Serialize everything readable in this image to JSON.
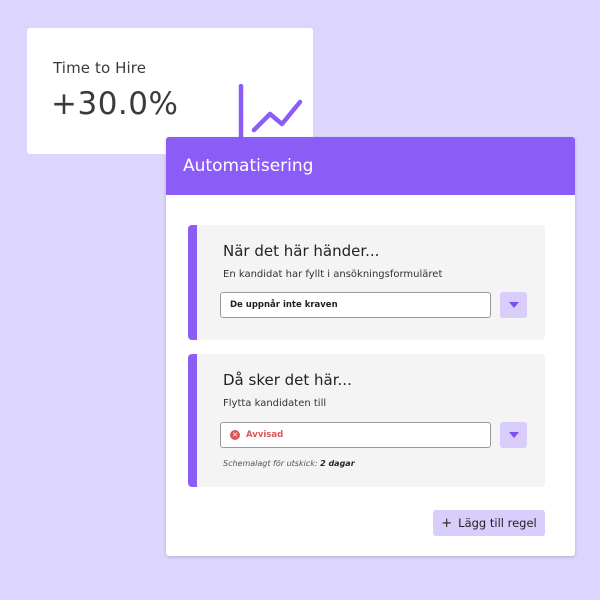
{
  "stat": {
    "label": "Time to Hire",
    "value": "+30.0%",
    "icon": "line-chart-icon",
    "icon_color": "#8b5cf6"
  },
  "automation": {
    "title": "Automatisering",
    "header_color": "#8b5cf6",
    "rules": [
      {
        "title": "När det här händer...",
        "subtitle": "En kandidat har fyllt i ansökningsformuläret",
        "select_value": "De uppnår inte kraven"
      },
      {
        "title": "Då sker det här...",
        "subtitle": "Flytta kandidaten till",
        "select_value": "Avvisad",
        "select_icon": "x-circle-icon",
        "select_color": "#e05656",
        "schedule_label": "Schemalagt för utskick:",
        "schedule_value": "2 dagar"
      }
    ],
    "add_button": {
      "icon": "+",
      "label": "Lägg till regel"
    }
  }
}
